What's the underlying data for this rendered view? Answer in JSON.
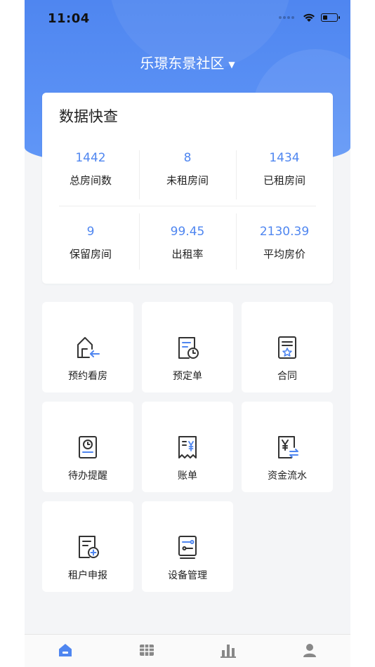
{
  "status_bar": {
    "time": "11:04"
  },
  "header": {
    "community_name": "乐璟东景社区"
  },
  "stats": {
    "title": "数据快查",
    "items": [
      {
        "value": "1442",
        "label": "总房间数"
      },
      {
        "value": "8",
        "label": "未租房间"
      },
      {
        "value": "1434",
        "label": "已租房间"
      },
      {
        "value": "9",
        "label": "保留房间"
      },
      {
        "value": "99.45",
        "label": "出租率"
      },
      {
        "value": "2130.39",
        "label": "平均房价"
      }
    ]
  },
  "menu": [
    {
      "label": "预约看房",
      "icon": "house-arrow-icon"
    },
    {
      "label": "预定单",
      "icon": "document-clock-icon"
    },
    {
      "label": "合同",
      "icon": "contract-star-icon"
    },
    {
      "label": "待办提醒",
      "icon": "reminder-clock-icon"
    },
    {
      "label": "账单",
      "icon": "bill-yuan-icon"
    },
    {
      "label": "资金流水",
      "icon": "funds-flow-icon"
    },
    {
      "label": "租户申报",
      "icon": "tenant-report-icon"
    },
    {
      "label": "设备管理",
      "icon": "device-management-icon"
    }
  ],
  "tabs": [
    {
      "icon": "home-icon",
      "active": true
    },
    {
      "icon": "grid-icon",
      "active": false
    },
    {
      "icon": "bar-chart-icon",
      "active": false
    },
    {
      "icon": "user-icon",
      "active": false
    }
  ],
  "colors": {
    "primary": "#4f86f0",
    "text": "#222222",
    "background": "#f4f5f7"
  }
}
